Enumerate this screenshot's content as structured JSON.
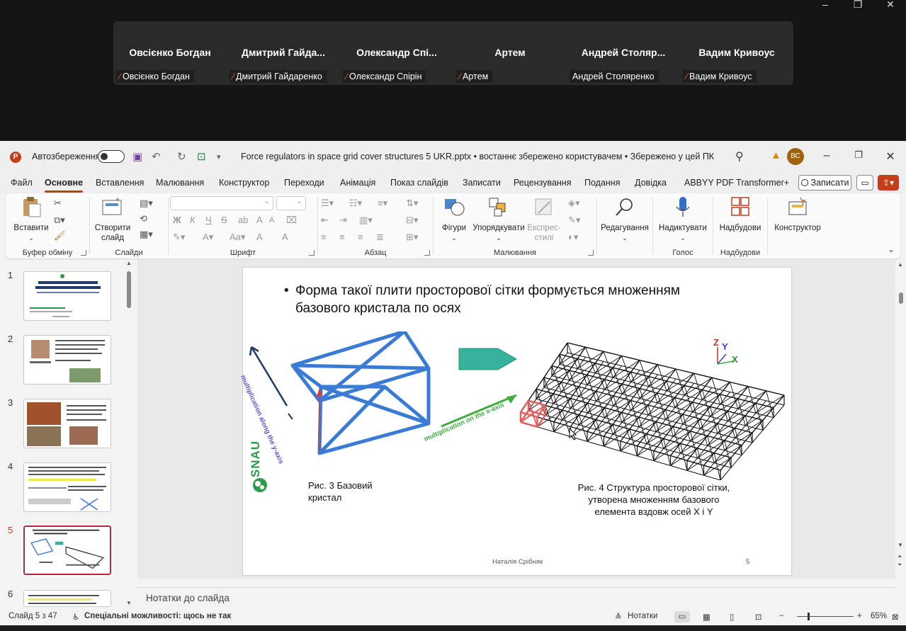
{
  "meeting": {
    "participants": [
      {
        "display": "Овсієнко Богдан",
        "tag": "Овсієнко Богдан",
        "muted": true
      },
      {
        "display": "Дмитрий Гайда...",
        "tag": "Дмитрий Гайдаренко",
        "muted": true
      },
      {
        "display": "Олександр Спі...",
        "tag": "Олександр Спірін",
        "muted": true
      },
      {
        "display": "Артем",
        "tag": "Артем",
        "muted": true
      },
      {
        "display": "Андрей Столяр...",
        "tag": "Андрей Столяренко",
        "muted": false
      },
      {
        "display": "Вадим Кривоус",
        "tag": "Вадим Кривоус",
        "muted": true
      }
    ]
  },
  "ppt": {
    "app_letter": "P",
    "autosave_label": "Автозбереження",
    "doc_title": "Force regulators in space grid cover structures 5 UKR.pptx  •  востаннє збережено користувачем  •  Збережено у цей ПК",
    "avatar_initials": "ВС",
    "tabs": [
      "Файл",
      "Основне",
      "Вставлення",
      "Малювання",
      "Конструктор",
      "Переходи",
      "Анімація",
      "Показ слайдів",
      "Записати",
      "Рецензування",
      "Подання",
      "Довідка",
      "ABBYY PDF Transformer+"
    ],
    "active_tab": "Основне",
    "record_button": "Записати",
    "ribbon": {
      "paste": "Вставити",
      "clipboard_group": "Буфер обміну",
      "new_slide_line1": "Створити",
      "new_slide_line2": "слайд",
      "slides_group": "Слайди",
      "font_group": "Шрифт",
      "paragraph_group": "Абзац",
      "shapes": "Фігури",
      "arrange": "Упорядкувати",
      "quick_styles_line1": "Експрес-",
      "quick_styles_line2": "стилі",
      "drawing_group": "Малювання",
      "editing": "Редагування",
      "dictate": "Надиктувати",
      "voice_group": "Голос",
      "addins": "Надбудови",
      "addins_group": "Надбудови",
      "designer": "Конструктор",
      "bold": "Ж",
      "italic": "К",
      "underline": "Ч",
      "strike": "S",
      "font_size_up": "A",
      "font_size_down": "A"
    },
    "thumbnails": [
      {
        "num": "1"
      },
      {
        "num": "2"
      },
      {
        "num": "3"
      },
      {
        "num": "4"
      },
      {
        "num": "5"
      },
      {
        "num": "6"
      }
    ],
    "active_slide": "5",
    "slide": {
      "bullet_line1": "Форма такої плити просторової сітки формується множенням",
      "bullet_line2": "базового кристала по осях",
      "caption_left_line1": "Рис. 3 Базовий",
      "caption_left_line2": "кристал",
      "caption_right_line1": "Рис. 4 Структура просторової сітки,",
      "caption_right_line2": "утворена множенням базового",
      "caption_right_line3": "елемента вздовж осей X і Y",
      "label_y_axis": "multiplication along the y-axis",
      "label_x_axis": "multiplication on the x-axis",
      "axis_z": "Z",
      "axis_y": "Y",
      "axis_x": "X",
      "logo_text": "SNAU",
      "footer_name": "Наталія Срібняк",
      "footer_num": "5"
    },
    "notes_placeholder": "Нотатки до слайда",
    "status": {
      "slide_counter": "Слайд 5 з 47",
      "accessibility": "Спеціальні можливості: щось не так",
      "notes_button": "Нотатки",
      "zoom": "65%",
      "zoom_minus": "−",
      "zoom_plus": "+"
    },
    "colors": {
      "accent": "#c43e1c",
      "active_thumb_border": "#b5283a"
    }
  }
}
